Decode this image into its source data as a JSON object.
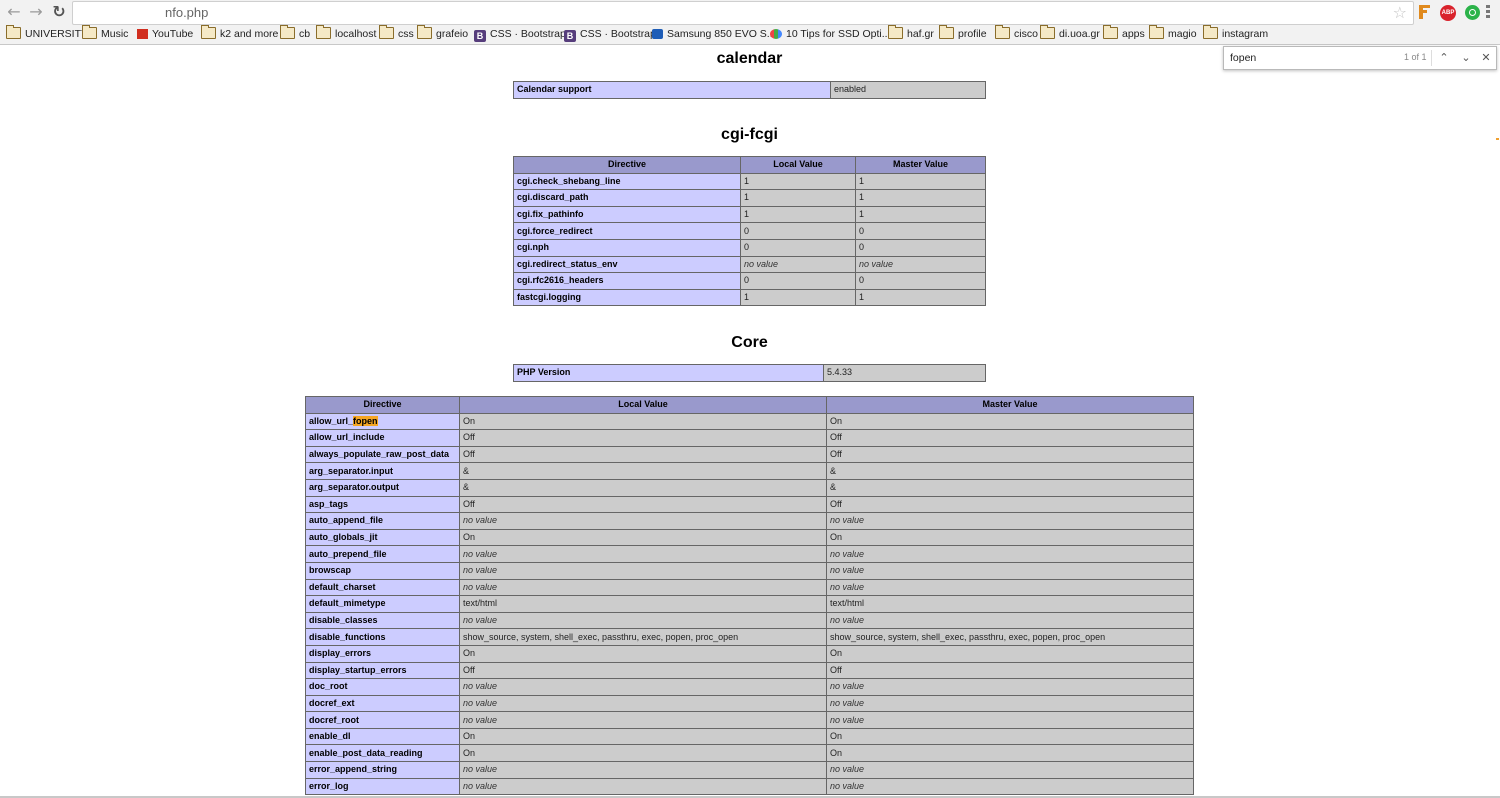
{
  "browser": {
    "url_suffix": "nfo.php",
    "extension_abp": "ABP",
    "bookmarks": [
      {
        "label": "UNIVERSITY",
        "icon": "folder-icon"
      },
      {
        "label": "Music",
        "icon": "folder-icon"
      },
      {
        "label": "YouTube",
        "icon": "youtube-icon"
      },
      {
        "label": "k2 and more",
        "icon": "folder-icon"
      },
      {
        "label": "cb",
        "icon": "folder-icon"
      },
      {
        "label": "localhost",
        "icon": "folder-icon"
      },
      {
        "label": "css",
        "icon": "folder-icon"
      },
      {
        "label": "grafeio",
        "icon": "folder-icon"
      },
      {
        "label": "CSS · Bootstrap",
        "icon": "bootstrap-icon"
      },
      {
        "label": "CSS · Bootstrap",
        "icon": "bootstrap-icon"
      },
      {
        "label": "Samsung 850 EVO S...",
        "icon": "samsung-icon"
      },
      {
        "label": "10 Tips for SSD Opti...",
        "icon": "site-icon"
      },
      {
        "label": "haf.gr",
        "icon": "folder-icon"
      },
      {
        "label": "profile",
        "icon": "folder-icon"
      },
      {
        "label": "cisco",
        "icon": "folder-icon"
      },
      {
        "label": "di.uoa.gr",
        "icon": "folder-icon"
      },
      {
        "label": "apps",
        "icon": "folder-icon"
      },
      {
        "label": "magio",
        "icon": "folder-icon"
      },
      {
        "label": "instagram",
        "icon": "folder-icon"
      }
    ]
  },
  "find": {
    "query": "fopen",
    "count": "1 of 1"
  },
  "calendar": {
    "title": "calendar",
    "label": "Calendar support",
    "value": "enabled"
  },
  "cgi": {
    "title": "cgi-fcgi",
    "headers": [
      "Directive",
      "Local Value",
      "Master Value"
    ],
    "rows": [
      [
        "cgi.check_shebang_line",
        "1",
        "1"
      ],
      [
        "cgi.discard_path",
        "1",
        "1"
      ],
      [
        "cgi.fix_pathinfo",
        "1",
        "1"
      ],
      [
        "cgi.force_redirect",
        "0",
        "0"
      ],
      [
        "cgi.nph",
        "0",
        "0"
      ],
      [
        "cgi.redirect_status_env",
        "no value",
        "no value"
      ],
      [
        "cgi.rfc2616_headers",
        "0",
        "0"
      ],
      [
        "fastcgi.logging",
        "1",
        "1"
      ]
    ]
  },
  "core": {
    "title": "Core",
    "version_label": "PHP Version",
    "version_value": "5.4.33",
    "headers": [
      "Directive",
      "Local Value",
      "Master Value"
    ],
    "first_row_prefix": "allow_url_",
    "first_row_match": "fopen",
    "first_row_local": "On",
    "first_row_master": "On",
    "rows": [
      [
        "allow_url_include",
        "Off",
        "Off"
      ],
      [
        "always_populate_raw_post_data",
        "Off",
        "Off"
      ],
      [
        "arg_separator.input",
        "&",
        "&"
      ],
      [
        "arg_separator.output",
        "&",
        "&"
      ],
      [
        "asp_tags",
        "Off",
        "Off"
      ],
      [
        "auto_append_file",
        "no value",
        "no value"
      ],
      [
        "auto_globals_jit",
        "On",
        "On"
      ],
      [
        "auto_prepend_file",
        "no value",
        "no value"
      ],
      [
        "browscap",
        "no value",
        "no value"
      ],
      [
        "default_charset",
        "no value",
        "no value"
      ],
      [
        "default_mimetype",
        "text/html",
        "text/html"
      ],
      [
        "disable_classes",
        "no value",
        "no value"
      ],
      [
        "disable_functions",
        "show_source, system, shell_exec, passthru, exec, popen, proc_open",
        "show_source, system, shell_exec, passthru, exec, popen, proc_open"
      ],
      [
        "display_errors",
        "On",
        "On"
      ],
      [
        "display_startup_errors",
        "Off",
        "Off"
      ],
      [
        "doc_root",
        "no value",
        "no value"
      ],
      [
        "docref_ext",
        "no value",
        "no value"
      ],
      [
        "docref_root",
        "no value",
        "no value"
      ],
      [
        "enable_dl",
        "On",
        "On"
      ],
      [
        "enable_post_data_reading",
        "On",
        "On"
      ],
      [
        "error_append_string",
        "no value",
        "no value"
      ],
      [
        "error_log",
        "no value",
        "no value"
      ]
    ]
  }
}
